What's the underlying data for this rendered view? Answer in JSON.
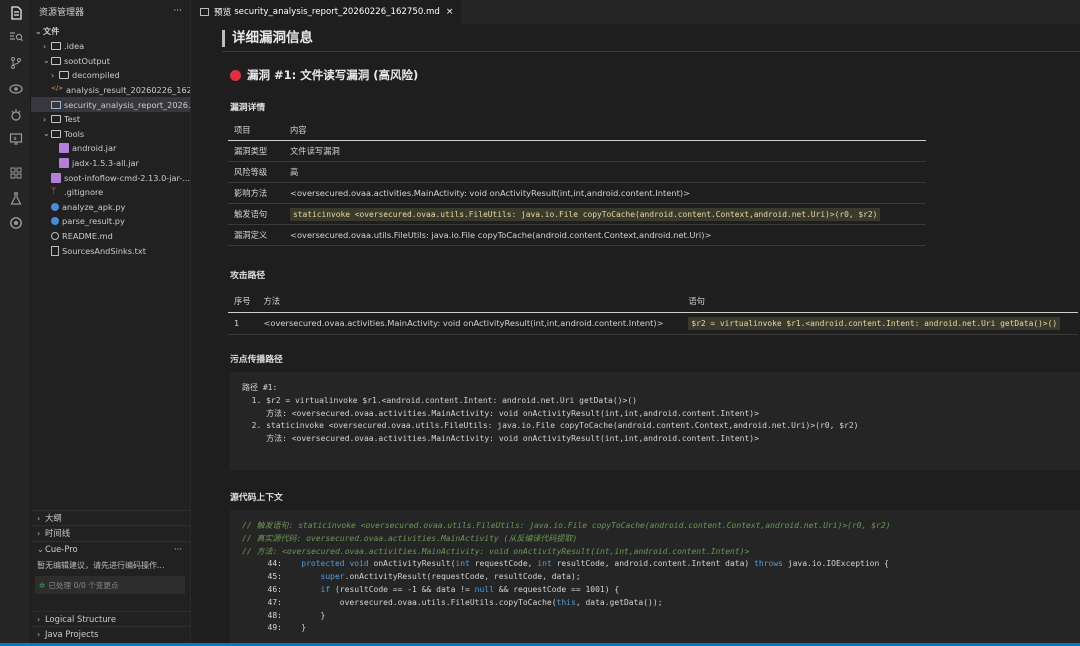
{
  "activity_bar": {
    "icons": [
      "explorer-icon",
      "search-icon",
      "source-control-icon",
      "run-debug-icon",
      "extensions-icon",
      "remote-icon",
      "grid-icon",
      "flask-icon",
      "settings-icon"
    ]
  },
  "explorer": {
    "title": "资源管理器",
    "more": "···",
    "root": "文件",
    "items": [
      {
        "label": ".idea",
        "indent": 1,
        "type": "folder",
        "expanded": false
      },
      {
        "label": "sootOutput",
        "indent": 1,
        "type": "folder",
        "expanded": true
      },
      {
        "label": "decompiled",
        "indent": 2,
        "type": "folder",
        "expanded": false
      },
      {
        "label": "analysis_result_20260226_162...",
        "indent": 2,
        "type": "code"
      },
      {
        "label": "security_analysis_report_2026...",
        "indent": 2,
        "type": "preview",
        "selected": true
      },
      {
        "label": "Test",
        "indent": 1,
        "type": "folder",
        "expanded": false
      },
      {
        "label": "Tools",
        "indent": 1,
        "type": "folder",
        "expanded": true
      },
      {
        "label": "android.jar",
        "indent": 2,
        "type": "jar"
      },
      {
        "label": "jadx-1.5.3-all.jar",
        "indent": 2,
        "type": "jar"
      },
      {
        "label": "soot-infoflow-cmd-2.13.0-jar-...",
        "indent": 2,
        "type": "jar"
      },
      {
        "label": ".gitignore",
        "indent": 1,
        "type": "git"
      },
      {
        "label": "analyze_apk.py",
        "indent": 1,
        "type": "py"
      },
      {
        "label": "parse_result.py",
        "indent": 1,
        "type": "py"
      },
      {
        "label": "README.md",
        "indent": 1,
        "type": "info"
      },
      {
        "label": "SourcesAndSinks.txt",
        "indent": 1,
        "type": "txt"
      }
    ]
  },
  "panels": {
    "outline": "大纲",
    "timeline": "时间线",
    "cue_pro": "Cue-Pro",
    "cue_more": "···",
    "cue_message": "暂无编辑建议，请先进行编码操作...",
    "cue_status": "已处理 0/0 个变更点",
    "logical_structure": "Logical Structure",
    "java_projects": "Java Projects"
  },
  "tab": {
    "prefix": "预览",
    "title": "security_analysis_report_20260226_162750.md",
    "close": "×"
  },
  "report": {
    "heading": "详细漏洞信息",
    "vuln_title": "漏洞 #1: 文件读写漏洞 (高风险)",
    "details_heading": "漏洞详情",
    "details_headers": [
      "项目",
      "内容"
    ],
    "details_rows": [
      {
        "key": "漏洞类型",
        "value": "文件读写漏洞"
      },
      {
        "key": "风险等级",
        "value": "高"
      },
      {
        "key": "影响方法",
        "value": "<oversecured.ovaa.activities.MainActivity: void onActivityResult(int,int,android.content.Intent)>"
      },
      {
        "key": "触发语句",
        "value": "staticinvoke <oversecured.ovaa.utils.FileUtils: java.io.File copyToCache(android.content.Context,android.net.Uri)>(r0, $r2)",
        "code": true
      },
      {
        "key": "漏洞定义",
        "value": "<oversecured.ovaa.utils.FileUtils: java.io.File copyToCache(android.content.Context,android.net.Uri)>"
      }
    ],
    "attack_heading": "攻击路径",
    "attack_headers": [
      "序号",
      "方法",
      "语句"
    ],
    "attack_rows": [
      {
        "no": "1",
        "method": "<oversecured.ovaa.activities.MainActivity: void onActivityResult(int,int,android.content.Intent)>",
        "stmt": "$r2 = virtualinvoke $r1.<android.content.Intent: android.net.Uri getData()>()"
      }
    ],
    "taint_heading": "污点传播路径",
    "taint_lines": [
      "路径 #1:",
      "  1. $r2 = virtualinvoke $r1.<android.content.Intent: android.net.Uri getData()>()",
      "     方法: <oversecured.ovaa.activities.MainActivity: void onActivityResult(int,int,android.content.Intent)>",
      "  2. staticinvoke <oversecured.ovaa.utils.FileUtils: java.io.File copyToCache(android.content.Context,android.net.Uri)>(r0, $r2)",
      "     方法: <oversecured.ovaa.activities.MainActivity: void onActivityResult(int,int,android.content.Intent)>"
    ],
    "source_heading": "源代码上下文",
    "source_comments": [
      "// 触发语句: staticinvoke <oversecured.ovaa.utils.FileUtils: java.io.File copyToCache(android.content.Context,android.net.Uri)>(r0, $r2)",
      "// 真实源代码: oversecured.ovaa.activities.MainActivity (从反编译代码提取)",
      "// 方法: <oversecured.ovaa.activities.MainActivity: void onActivityResult(int,int,android.content.Intent)>"
    ],
    "source_lines": [
      {
        "n": "44:",
        "code": "    protected void onActivityResult(int requestCode, int resultCode, android.content.Intent data) throws java.io.IOException {"
      },
      {
        "n": "45:",
        "code": "        super.onActivityResult(requestCode, resultCode, data);"
      },
      {
        "n": "46:",
        "code": "        if (resultCode == -1 && data != null && requestCode == 1001) {"
      },
      {
        "n": "47:",
        "code": "            oversecured.ovaa.utils.FileUtils.copyToCache(this, data.getData());"
      },
      {
        "n": "48:",
        "code": "        }"
      },
      {
        "n": "49:",
        "code": "    }"
      }
    ]
  }
}
